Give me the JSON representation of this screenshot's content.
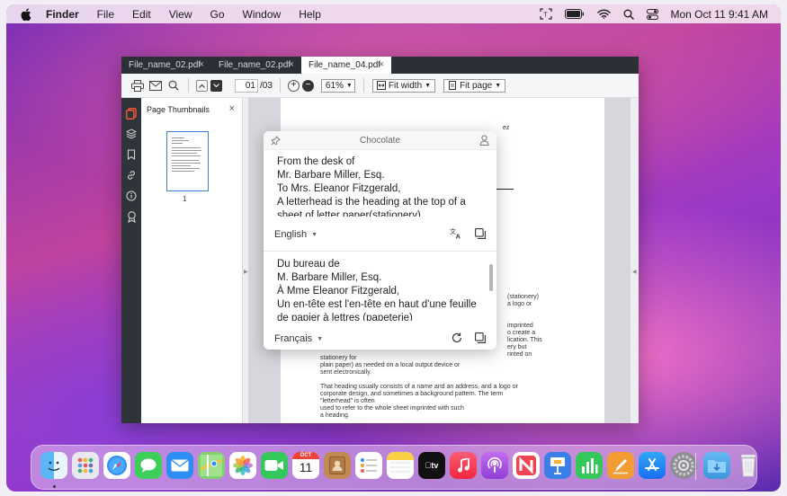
{
  "menubar": {
    "items": [
      "Finder",
      "File",
      "Edit",
      "View",
      "Go",
      "Window",
      "Help"
    ],
    "datetime": "Mon Oct 11  9:41 AM"
  },
  "tabs": [
    {
      "label": "File_name_02.pdf",
      "active": false
    },
    {
      "label": "File_name_02.pdf",
      "active": false
    },
    {
      "label": "File_name_04.pdf",
      "active": true
    }
  ],
  "toolbar": {
    "page_current": "01",
    "page_total": "/03",
    "zoom": "61%",
    "fit_width": "Fit width",
    "fit_page": "Fit page"
  },
  "thumbnails": {
    "title": "Page Thumbnails",
    "page_label": "1"
  },
  "document": {
    "fragment_ez": "ez",
    "right_fragments": [
      "(stationery)",
      "a logo or",
      "",
      "",
      "imprinted",
      "o create a",
      "lication. This",
      "ery but",
      "rinted on"
    ],
    "lines_bottom": [
      "stationery for",
      "plain paper) as needed on a local output device or",
      "sent electronically.",
      "",
      "That heading usually consists of a name and an address, and a logo or",
      "corporate design, and sometimes a background pattern. The term",
      "\"letterhead\" is often",
      "used to refer to the whole sheet imprinted with such",
      "a heading."
    ]
  },
  "popup": {
    "title": "Chocolate",
    "source_lines": [
      "From the desk of",
      "Mr. Barbare Miller, Esq.",
      "To Mrs. Eleanor Fitzgerald,",
      "A letterhead is the heading at the top of a",
      "sheet of letter paper(stationery)"
    ],
    "source_language": "English",
    "target_lines": [
      "Du bureau de",
      "M. Barbare Miller, Esq.",
      "À Mme Eleanor Fitzgerald,",
      "Un en-tête est l'en-tête en haut d'une feuille",
      "de papier à lettres (papeterie)"
    ],
    "target_language": "Français"
  },
  "dock": {
    "calendar_month": "OCT",
    "calendar_day": "11",
    "tv_label": "tv"
  }
}
